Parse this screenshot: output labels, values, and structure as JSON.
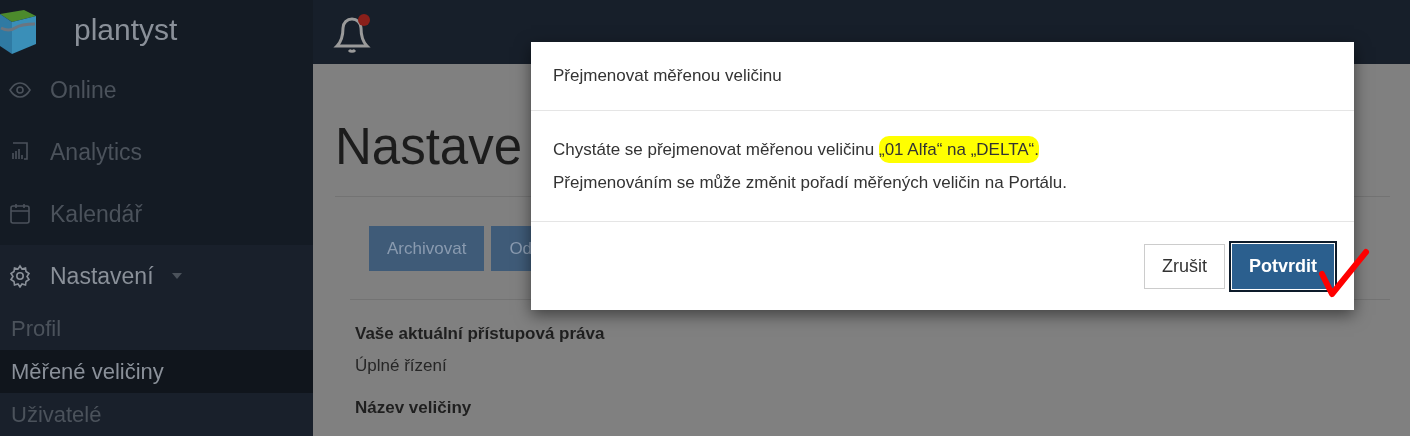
{
  "brand": {
    "name": "plantyst"
  },
  "sidebar": {
    "items": [
      {
        "label": "Online",
        "selected": false
      },
      {
        "label": "Analytics",
        "selected": false
      },
      {
        "label": "Kalendář",
        "selected": false
      },
      {
        "label": "Nastavení",
        "selected": true,
        "expanded": true,
        "children": [
          {
            "label": "Profil",
            "selected": false
          },
          {
            "label": "Měřené veličiny",
            "selected": true
          },
          {
            "label": "Uživatelé",
            "selected": false
          }
        ]
      }
    ]
  },
  "topbar": {
    "notifications": {
      "unread": true
    }
  },
  "page": {
    "title": "Nastave",
    "actions": [
      "Archivovat",
      "Od"
    ],
    "fields": [
      {
        "label": "Vaše aktuální přístupová práva",
        "value": "Úplné řízení"
      },
      {
        "label": "Název veličiny"
      }
    ]
  },
  "dialog": {
    "title": "Přejmenovat měřenou veličinu",
    "body": [
      [
        {
          "text": "Chystáte se přejmenovat měřenou veličinu ",
          "highlighted": false
        },
        {
          "text": "„01 Alfa“ na „DELTA“.",
          "highlighted": true
        }
      ],
      [
        {
          "text": "Přejmenováním se může změnit pořadí měřených veličin na Portálu.",
          "highlighted": false
        }
      ]
    ],
    "buttons": [
      {
        "label": "Zrušit",
        "kind": "secondary",
        "focused": false
      },
      {
        "label": "Potvrdit",
        "kind": "primary",
        "focused": true
      }
    ],
    "annotation": {
      "kind": "checkmark"
    }
  }
}
